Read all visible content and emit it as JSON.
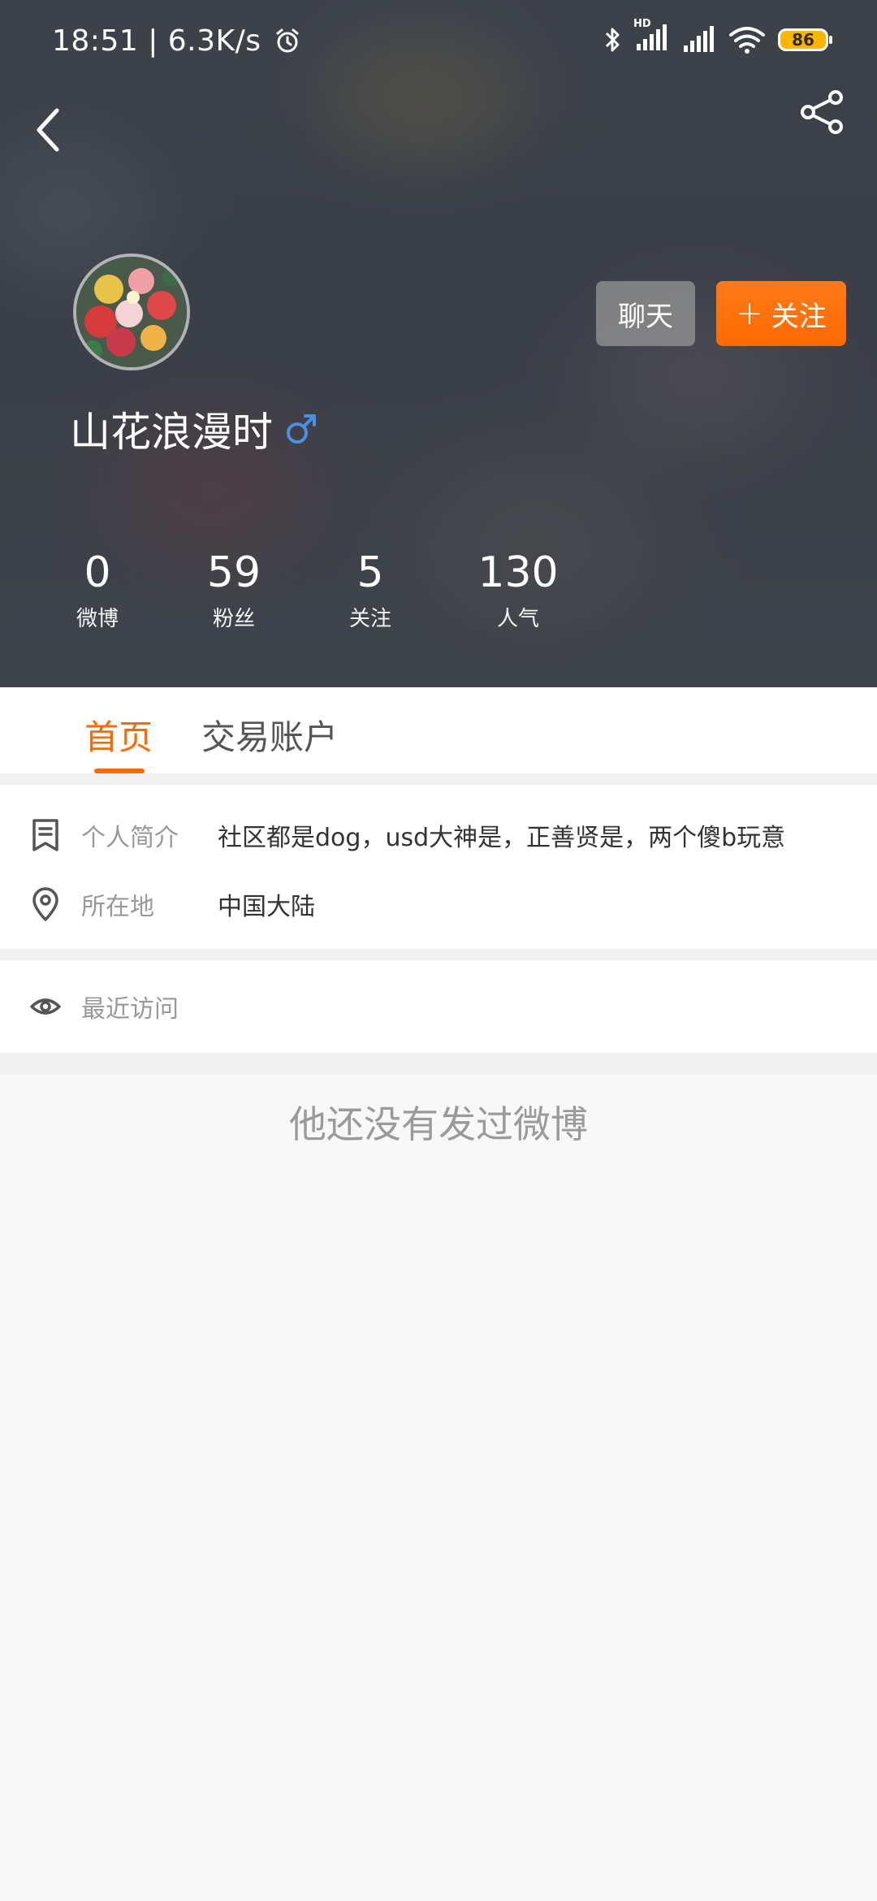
{
  "status_bar": {
    "time": "18:51",
    "speed": "6.3K/s",
    "battery": "86",
    "hd_label": "HD"
  },
  "profile": {
    "username": "山花浪漫时",
    "gender": "male"
  },
  "buttons": {
    "chat": "聊天",
    "follow": "关注",
    "follow_plus": "+"
  },
  "stats": [
    {
      "value": "0",
      "label": "微博"
    },
    {
      "value": "59",
      "label": "粉丝"
    },
    {
      "value": "5",
      "label": "关注"
    },
    {
      "value": "130",
      "label": "人气"
    }
  ],
  "tabs": [
    {
      "label": "首页",
      "active": true
    },
    {
      "label": "交易账户",
      "active": false
    }
  ],
  "info": {
    "bio_label": "个人简介",
    "bio_value": "社区都是dog，usd大神是，正善贤是，两个傻b玩意",
    "location_label": "所在地",
    "location_value": "中国大陆"
  },
  "recent_visits_label": "最近访问",
  "empty_message": "他还没有发过微博",
  "colors": {
    "accent": "#ff6a00",
    "gender_male": "#4a90e2",
    "battery": "#ffb400"
  },
  "icons": {
    "back": "back-arrow-icon",
    "share": "share-icon",
    "bio": "bookmark-icon",
    "location": "location-pin-icon",
    "visits": "eye-icon",
    "gender": "male-icon"
  }
}
